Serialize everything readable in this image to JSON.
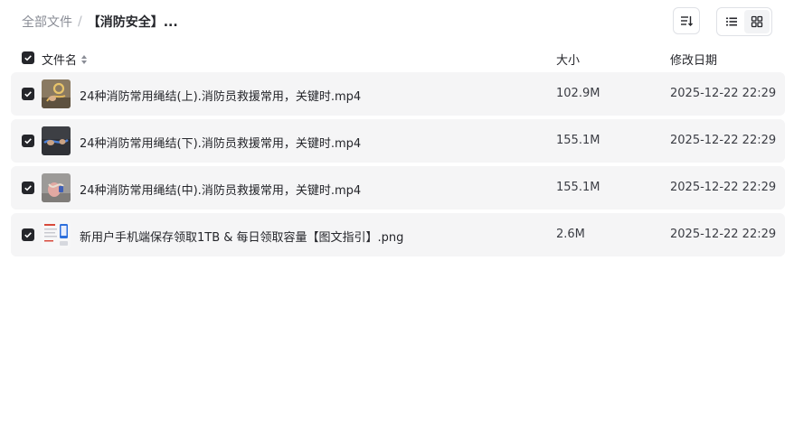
{
  "breadcrumb": {
    "root": "全部文件",
    "separator": "/",
    "current": "【消防安全】..."
  },
  "toolbar": {
    "sort_icon": "sort-icon",
    "list_view_icon": "list-view-icon",
    "grid_view_icon": "grid-view-icon"
  },
  "table": {
    "columns": {
      "name": "文件名",
      "size": "大小",
      "modified": "修改日期"
    },
    "rows": [
      {
        "name": "24种消防常用绳结(上).消防员救援常用，关键时.mp4",
        "size": "102.9M",
        "modified": "2025-12-22 22:29",
        "checked": true,
        "thumb": "video-thumbnail"
      },
      {
        "name": "24种消防常用绳结(下).消防员救援常用，关键时.mp4",
        "size": "155.1M",
        "modified": "2025-12-22 22:29",
        "checked": true,
        "thumb": "video-thumbnail"
      },
      {
        "name": "24种消防常用绳结(中).消防员救援常用，关键时.mp4",
        "size": "155.1M",
        "modified": "2025-12-22 22:29",
        "checked": true,
        "thumb": "video-thumbnail"
      },
      {
        "name": "新用户手机端保存领取1TB & 每日领取容量【图文指引】.png",
        "size": "2.6M",
        "modified": "2025-12-22 22:29",
        "checked": true,
        "thumb": "image-thumbnail"
      }
    ]
  },
  "colors": {
    "row_background": "#f5f5f6",
    "checkbox": "#25262b",
    "muted_text": "#8a8d96"
  }
}
